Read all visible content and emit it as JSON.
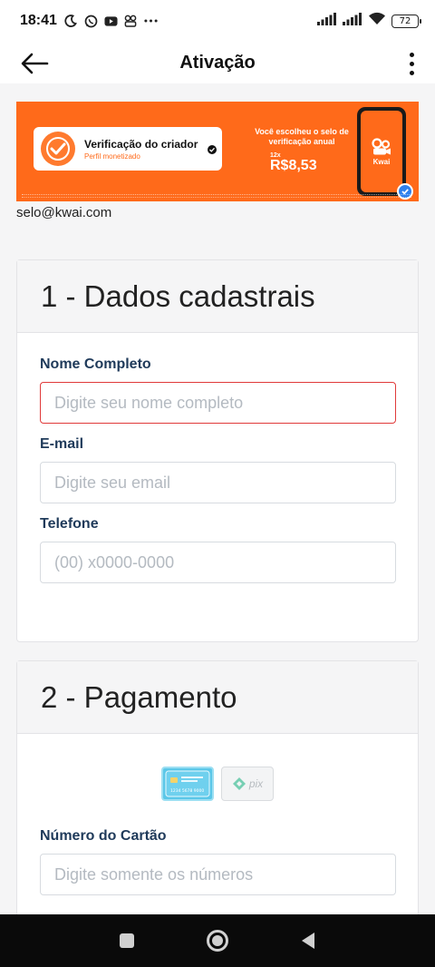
{
  "status_bar": {
    "time": "18:41",
    "battery": "72",
    "left_icons": [
      "moon-icon",
      "whatsapp-icon",
      "youtube-icon",
      "app-icon",
      "more-dots-icon"
    ],
    "right_icons": [
      "signal-icon",
      "signal-icon",
      "wifi-icon",
      "battery-icon"
    ]
  },
  "app_bar": {
    "title": "Ativação",
    "back_icon": "arrow-left-icon",
    "menu_icon": "more-vertical-icon"
  },
  "banner": {
    "card_title": "Verificação do criador",
    "card_subtitle": "Perfil monetizado",
    "headline_line1": "Você escolheu o selo de",
    "headline_line2": "verificação anual",
    "installments": "12x",
    "price": "R$8,53",
    "phone_brand": "Kwai",
    "accent_color": "#ff6a1a"
  },
  "banner_link": "selo@kwai.com",
  "sections": {
    "personal": {
      "title": "1 - Dados cadastrais",
      "fields": {
        "name": {
          "label": "Nome Completo",
          "placeholder": "Digite seu nome completo",
          "value": ""
        },
        "email": {
          "label": "E-mail",
          "placeholder": "Digite seu email",
          "value": ""
        },
        "phone": {
          "label": "Telefone",
          "placeholder": "(00) x0000-0000",
          "value": ""
        }
      }
    },
    "payment": {
      "title": "2 - Pagamento",
      "methods": [
        {
          "name": "credit-card",
          "selected": true,
          "card_number": "1234 5678 9000"
        },
        {
          "name": "pix",
          "selected": false,
          "label": "pix"
        }
      ],
      "fields": {
        "card_number": {
          "label": "Número do Cartão",
          "placeholder": "Digite somente os números",
          "value": ""
        }
      }
    }
  },
  "nav_bar": {
    "buttons": [
      "recents-square-icon",
      "home-circle-icon",
      "back-triangle-icon"
    ]
  }
}
